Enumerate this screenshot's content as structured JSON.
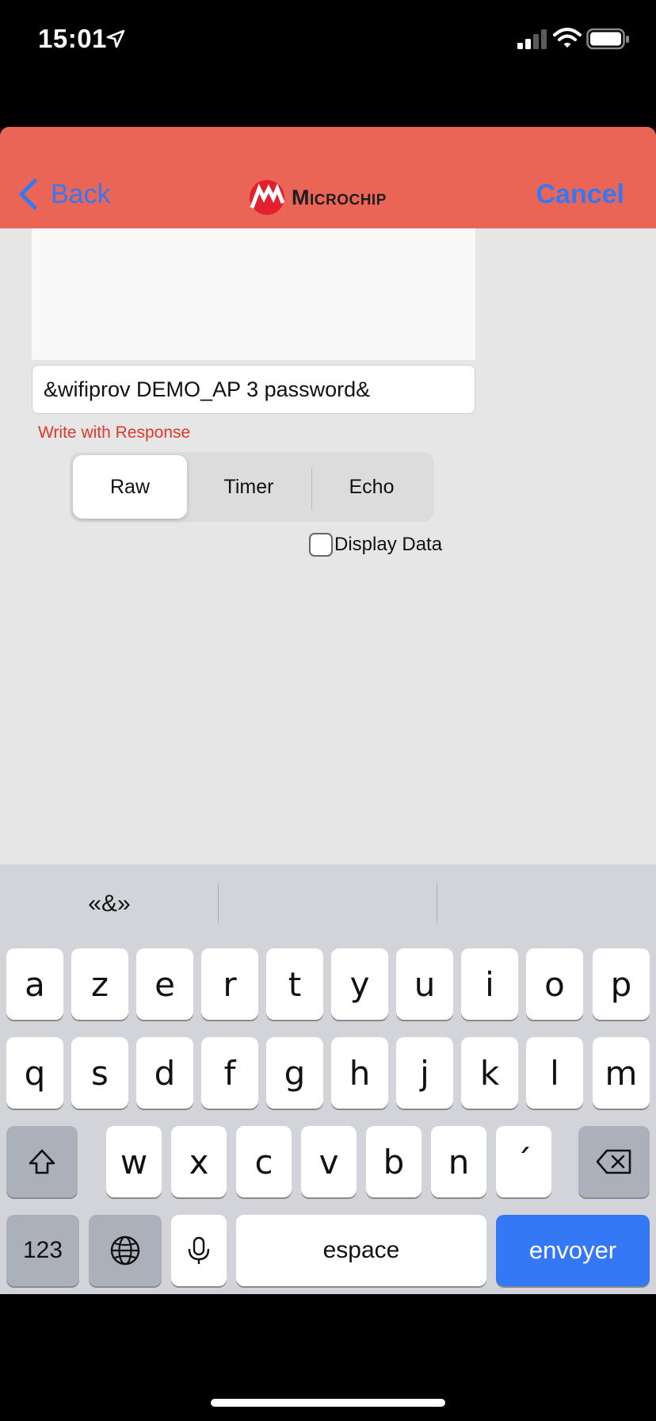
{
  "status_bar": {
    "time": "15:01"
  },
  "nav": {
    "back_label": "Back",
    "brand": "Microchip",
    "cancel_label": "Cancel",
    "bar_color": "#ea6556",
    "link_color": "#3478f6"
  },
  "terminal": {
    "input_value": "&wifiprov DEMO_AP 3 password&",
    "write_mode": "Write with Response",
    "segments": [
      {
        "label": "Raw",
        "selected": true
      },
      {
        "label": "Timer",
        "selected": false
      },
      {
        "label": "Echo",
        "selected": false
      }
    ],
    "display_data_label": "Display Data",
    "display_data_checked": false
  },
  "keyboard": {
    "suggestions": [
      "«&»",
      "",
      ""
    ],
    "row1": [
      "a",
      "z",
      "e",
      "r",
      "t",
      "y",
      "u",
      "i",
      "o",
      "p"
    ],
    "row2": [
      "q",
      "s",
      "d",
      "f",
      "g",
      "h",
      "j",
      "k",
      "l",
      "m"
    ],
    "row3": [
      "w",
      "x",
      "c",
      "v",
      "b",
      "n",
      "´"
    ],
    "numbers_label": "123",
    "space_label": "espace",
    "send_label": "envoyer",
    "send_color": "#3478f6"
  }
}
